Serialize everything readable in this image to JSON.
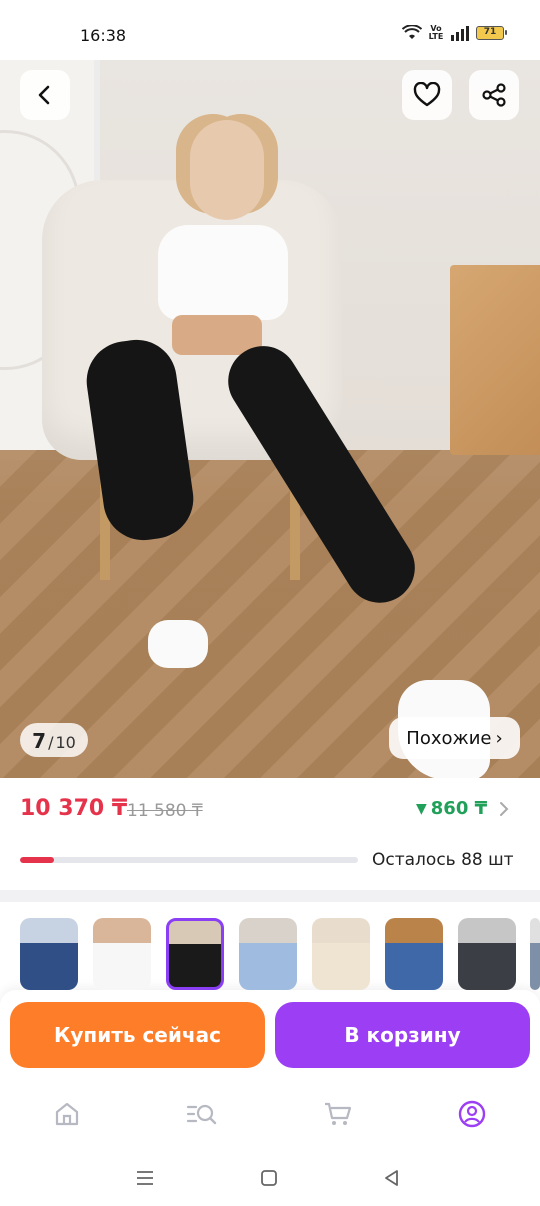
{
  "status_bar": {
    "time": "16:38",
    "network": "Vo LTE",
    "battery": "71"
  },
  "gallery": {
    "current": "7",
    "separator": "/",
    "total": "10",
    "similar_label": "Похожие",
    "similar_chevron": "›"
  },
  "pricing": {
    "price": "10 370 ₸",
    "old_price": "11 580 ₸",
    "bonus": "860 ₸",
    "bonus_arrow": "▼",
    "remaining_text": "Осталось 88 шт",
    "stock_progress": 0.1
  },
  "variants": [
    {
      "name": "blue-denim",
      "color": "#2f4f86",
      "top": "#c7d3e3"
    },
    {
      "name": "white",
      "color": "#f7f7f7",
      "top": "#d9b59a"
    },
    {
      "name": "black",
      "color": "#1a1a1a",
      "top": "#d8c8b6"
    },
    {
      "name": "light-blue",
      "color": "#9fbce0",
      "top": "#d9d2cb"
    },
    {
      "name": "cream",
      "color": "#efe3d2",
      "top": "#e8dccd"
    },
    {
      "name": "medium-blue",
      "color": "#3f68a8",
      "top": "#b9834a"
    },
    {
      "name": "dark-grey",
      "color": "#3b3e45",
      "top": "#c6c6c6"
    },
    {
      "name": "partial",
      "color": "#7e8fa8",
      "top": "#e0e0e0"
    }
  ],
  "selected_variant": 2,
  "actions": {
    "buy_now": "Купить сейчас",
    "add_to_cart": "В корзину"
  },
  "tabbar": {
    "tabs": [
      "home-icon",
      "catalog-search-icon",
      "cart-icon",
      "profile-icon"
    ],
    "active_color": "#9c3ff4",
    "inactive_color": "#b7b9c2"
  },
  "colors": {
    "accent": "#9c3ff4",
    "buy_now": "#fd7d28",
    "price": "#e5334b",
    "bonus": "#21a05a"
  }
}
